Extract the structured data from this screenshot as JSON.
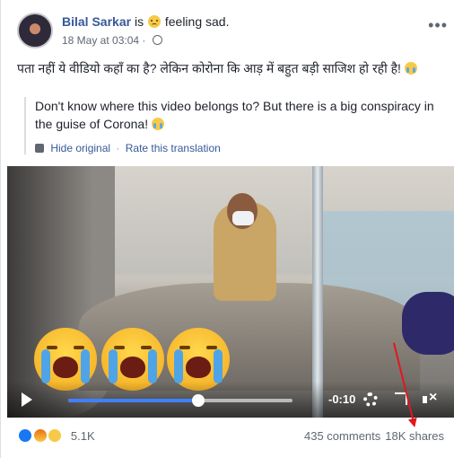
{
  "post": {
    "author": "Bilal Sarkar",
    "is_word": "is",
    "feeling": "feeling sad.",
    "feeling_icon": "sad-face-icon",
    "timestamp": "18 May at 03:04",
    "privacy_icon": "globe-icon",
    "more_label": "•••",
    "text_hindi": "पता नहीं ये वीडियो कहाँ का है? लेकिन कोरोना कि आड़ में बहुत बड़ी साजिश हो रही है!",
    "translation": "Don't know where this video belongs to? But there is a big conspiracy in the guise of Corona!",
    "translation_links": {
      "hide_original": "Hide original",
      "rate": "Rate this translation"
    }
  },
  "video": {
    "time_remaining": "-0:10",
    "progress_fraction": 0.58,
    "controls": [
      "play-icon",
      "gear-icon",
      "fullscreen-icon",
      "mute-icon"
    ]
  },
  "footer": {
    "reaction_icons": [
      "like-icon",
      "angry-icon",
      "sad-icon"
    ],
    "reaction_count": "5.1K",
    "comments": "435 comments",
    "shares": "18K shares"
  },
  "colors": {
    "link": "#385898",
    "progress": "#4080ff",
    "arrow": "#e3161c"
  }
}
